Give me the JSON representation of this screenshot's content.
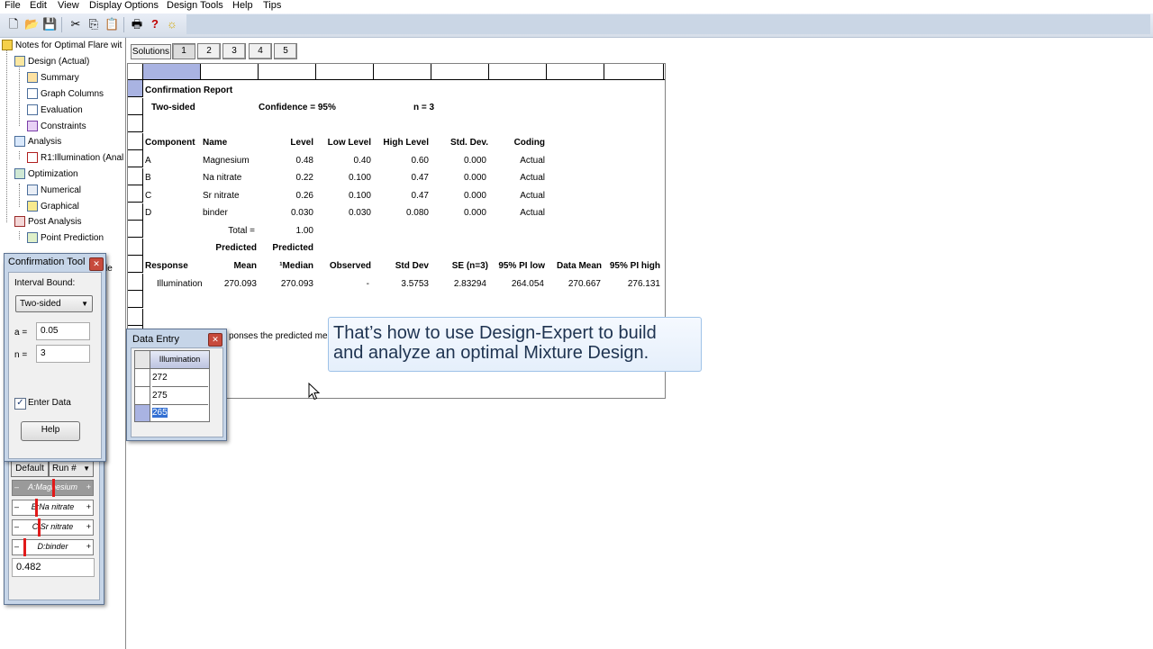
{
  "menu": [
    "File",
    "Edit",
    "View",
    "Display Options",
    "Design Tools",
    "Help",
    "Tips"
  ],
  "toolbar": {
    "icons": [
      "new-icon",
      "open-icon",
      "save-icon",
      "cut-icon",
      "copy-icon",
      "paste-icon",
      "print-icon",
      "help-icon",
      "tip-icon"
    ]
  },
  "tree": {
    "root": "Notes for Optimal Flare wit",
    "items": [
      "Design (Actual)",
      "Summary",
      "Graph Columns",
      "Evaluation",
      "Constraints",
      "Analysis",
      "R1:Illumination (Anal",
      "Optimization",
      "Numerical",
      "Graphical",
      "Post Analysis",
      "Point Prediction"
    ]
  },
  "solutions": {
    "label": "Solutions",
    "tabs": [
      "1",
      "2",
      "3",
      "4",
      "5"
    ]
  },
  "report": {
    "title": "Confirmation Report",
    "two_sided": "Two-sided",
    "confidence": "Confidence = 95%",
    "n": "n =  3",
    "comp_headers": [
      "Component",
      "Name",
      "Level",
      "Low Level",
      "High Level",
      "Std. Dev.",
      "Coding"
    ],
    "components": [
      [
        "A",
        "Magnesium",
        "0.48",
        "0.40",
        "0.60",
        "0.000",
        "Actual"
      ],
      [
        "B",
        "Na nitrate",
        "0.22",
        "0.100",
        "0.47",
        "0.000",
        "Actual"
      ],
      [
        "C",
        "Sr nitrate",
        "0.26",
        "0.100",
        "0.47",
        "0.000",
        "Actual"
      ],
      [
        "D",
        "binder",
        "0.030",
        "0.030",
        "0.080",
        "0.000",
        "Actual"
      ]
    ],
    "total_label": "Total =",
    "total_value": "1.00",
    "pred1": "Predicted",
    "pred2": "Predicted",
    "resp_headers": [
      "Response",
      "Mean",
      "¹Median",
      "Observed",
      "Std Dev",
      "SE (n=3)",
      "95% PI low",
      "Data Mean",
      "95% PI high"
    ],
    "response_row": [
      "Illumination",
      "270.093",
      "270.093",
      "-",
      "3.5753",
      "2.83294",
      "264.054",
      "270.667",
      "276.131"
    ],
    "footnote": "ponses the predicted mea"
  },
  "caption": {
    "line1": "That’s how to use Design-Expert to build",
    "line2": "and analyze an optimal Mixture Design."
  },
  "confirmation_tool": {
    "title": "Confirmation Tool",
    "interval_label": "Interval Bound:",
    "interval_value": "Two-sided",
    "alpha_label": "a =",
    "alpha_value": "0.05",
    "n_label": "n =",
    "n_value": "3",
    "enter_data": "Enter Data",
    "help": "Help",
    "behind_fragment": "le"
  },
  "data_entry": {
    "title": "Data Entry",
    "column": "Illumination",
    "values": [
      "272",
      "275",
      "265"
    ]
  },
  "factors": {
    "default": "Default",
    "run": "Run #",
    "sliders": [
      "A:Magnesium",
      "B:Na nitrate",
      "C:Sr nitrate",
      "D:binder"
    ],
    "slider_levels": [
      0.48,
      0.22,
      0.26,
      0.03
    ],
    "value": "0.482"
  }
}
